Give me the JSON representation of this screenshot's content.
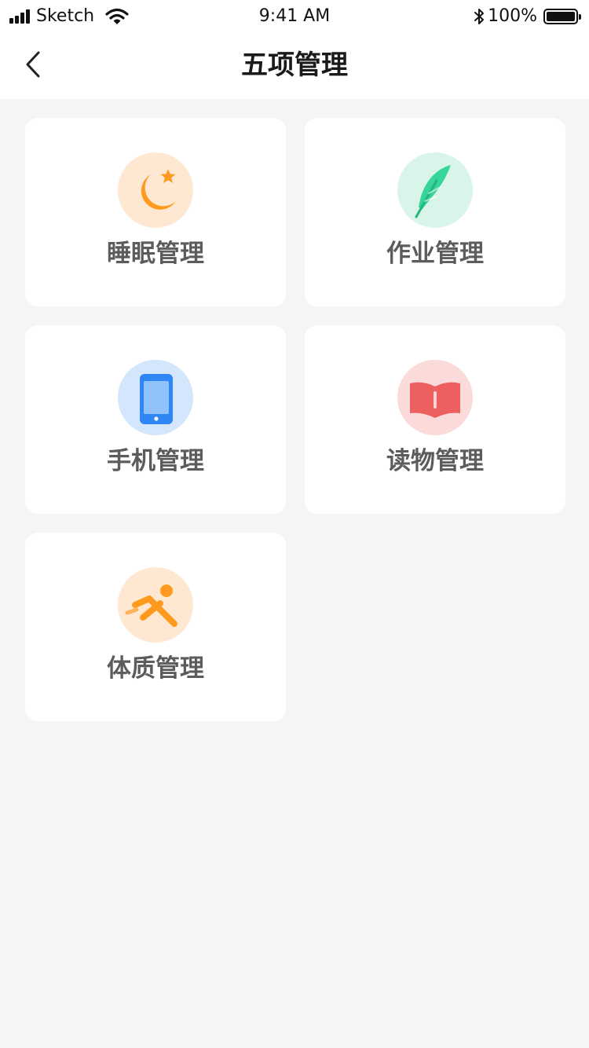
{
  "status_bar": {
    "carrier": "Sketch",
    "time": "9:41 AM",
    "battery": "100%"
  },
  "header": {
    "title": "五项管理"
  },
  "cards": [
    {
      "label": "睡眠管理",
      "icon": "moon-star-icon",
      "color": "#ff9a1f",
      "bg": "#ffe8d2"
    },
    {
      "label": "作业管理",
      "icon": "feather-icon",
      "color": "#36d59b",
      "bg": "#d9f5ea"
    },
    {
      "label": "手机管理",
      "icon": "phone-icon",
      "color": "#2f86f5",
      "bg": "#d3e6fb"
    },
    {
      "label": "读物管理",
      "icon": "book-icon",
      "color": "#ee5f5f",
      "bg": "#fbdada"
    },
    {
      "label": "体质管理",
      "icon": "runner-icon",
      "color": "#ff9a1f",
      "bg": "#ffe8d2"
    }
  ]
}
